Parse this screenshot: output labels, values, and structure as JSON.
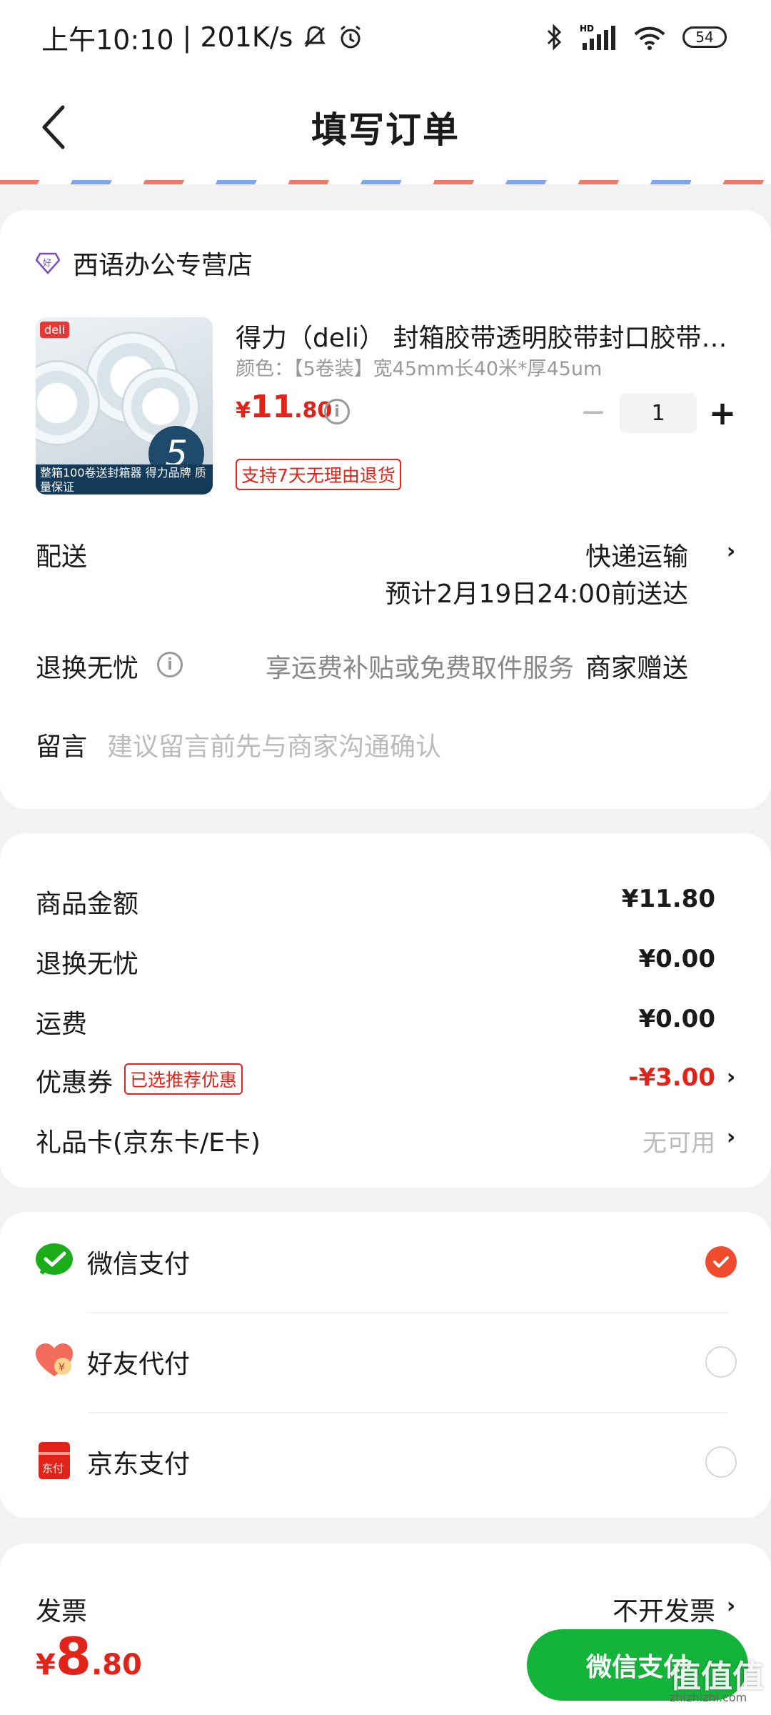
{
  "status_bar": {
    "time": "上午10:10",
    "separator": "|",
    "speed": "201K/s",
    "battery": "54",
    "signal_tag": "HD"
  },
  "header": {
    "title": "填写订单"
  },
  "store": {
    "name": "西语办公专营店"
  },
  "product": {
    "name": "得力（deli） 封箱胶带透明胶带封口胶带…",
    "spec": "颜色：【5卷装】宽45mm长40米*厚45um",
    "price_symbol": "¥",
    "price_int": "11",
    "price_dec": ".80",
    "quantity": "1",
    "return_badge": "支持7天无理由退货",
    "thumb_brand": "deli",
    "thumb_count": "5",
    "thumb_strip": "整箱100卷送封箱器 得力品牌 质量保证"
  },
  "delivery": {
    "label": "配送",
    "method": "快递运输",
    "eta": "预计2月19日24:00前送达"
  },
  "worry_free": {
    "label": "退换无忧",
    "desc": "享运费补贴或免费取件服务",
    "value": "商家赠送"
  },
  "message": {
    "label": "留言",
    "placeholder": "建议留言前先与商家沟通确认"
  },
  "summary": {
    "rows": [
      {
        "label": "商品金额",
        "value": "¥11.80"
      },
      {
        "label": "退换无忧",
        "value": "¥0.00"
      },
      {
        "label": "运费",
        "value": "¥0.00"
      }
    ],
    "coupon": {
      "label": "优惠券",
      "tag": "已选推荐优惠",
      "value": "-¥3.00"
    },
    "gift_card": {
      "label": "礼品卡(京东卡/E卡)",
      "value": "无可用"
    }
  },
  "payment": {
    "methods": [
      {
        "label": "微信支付",
        "selected": true
      },
      {
        "label": "好友代付",
        "selected": false
      },
      {
        "label": "京东支付",
        "selected": false
      }
    ]
  },
  "invoice": {
    "label": "发票",
    "value": "不开发票"
  },
  "footer": {
    "total_symbol": "¥",
    "total_int": "8",
    "total_dec": ".80",
    "pay_button": "微信支付",
    "watermark": "值值值",
    "watermark_sub": "zhizhizhi.com"
  },
  "colors": {
    "accent_red": "#e2231a",
    "wechat_green": "#14b33a",
    "radio_selected": "#f04b2c"
  }
}
